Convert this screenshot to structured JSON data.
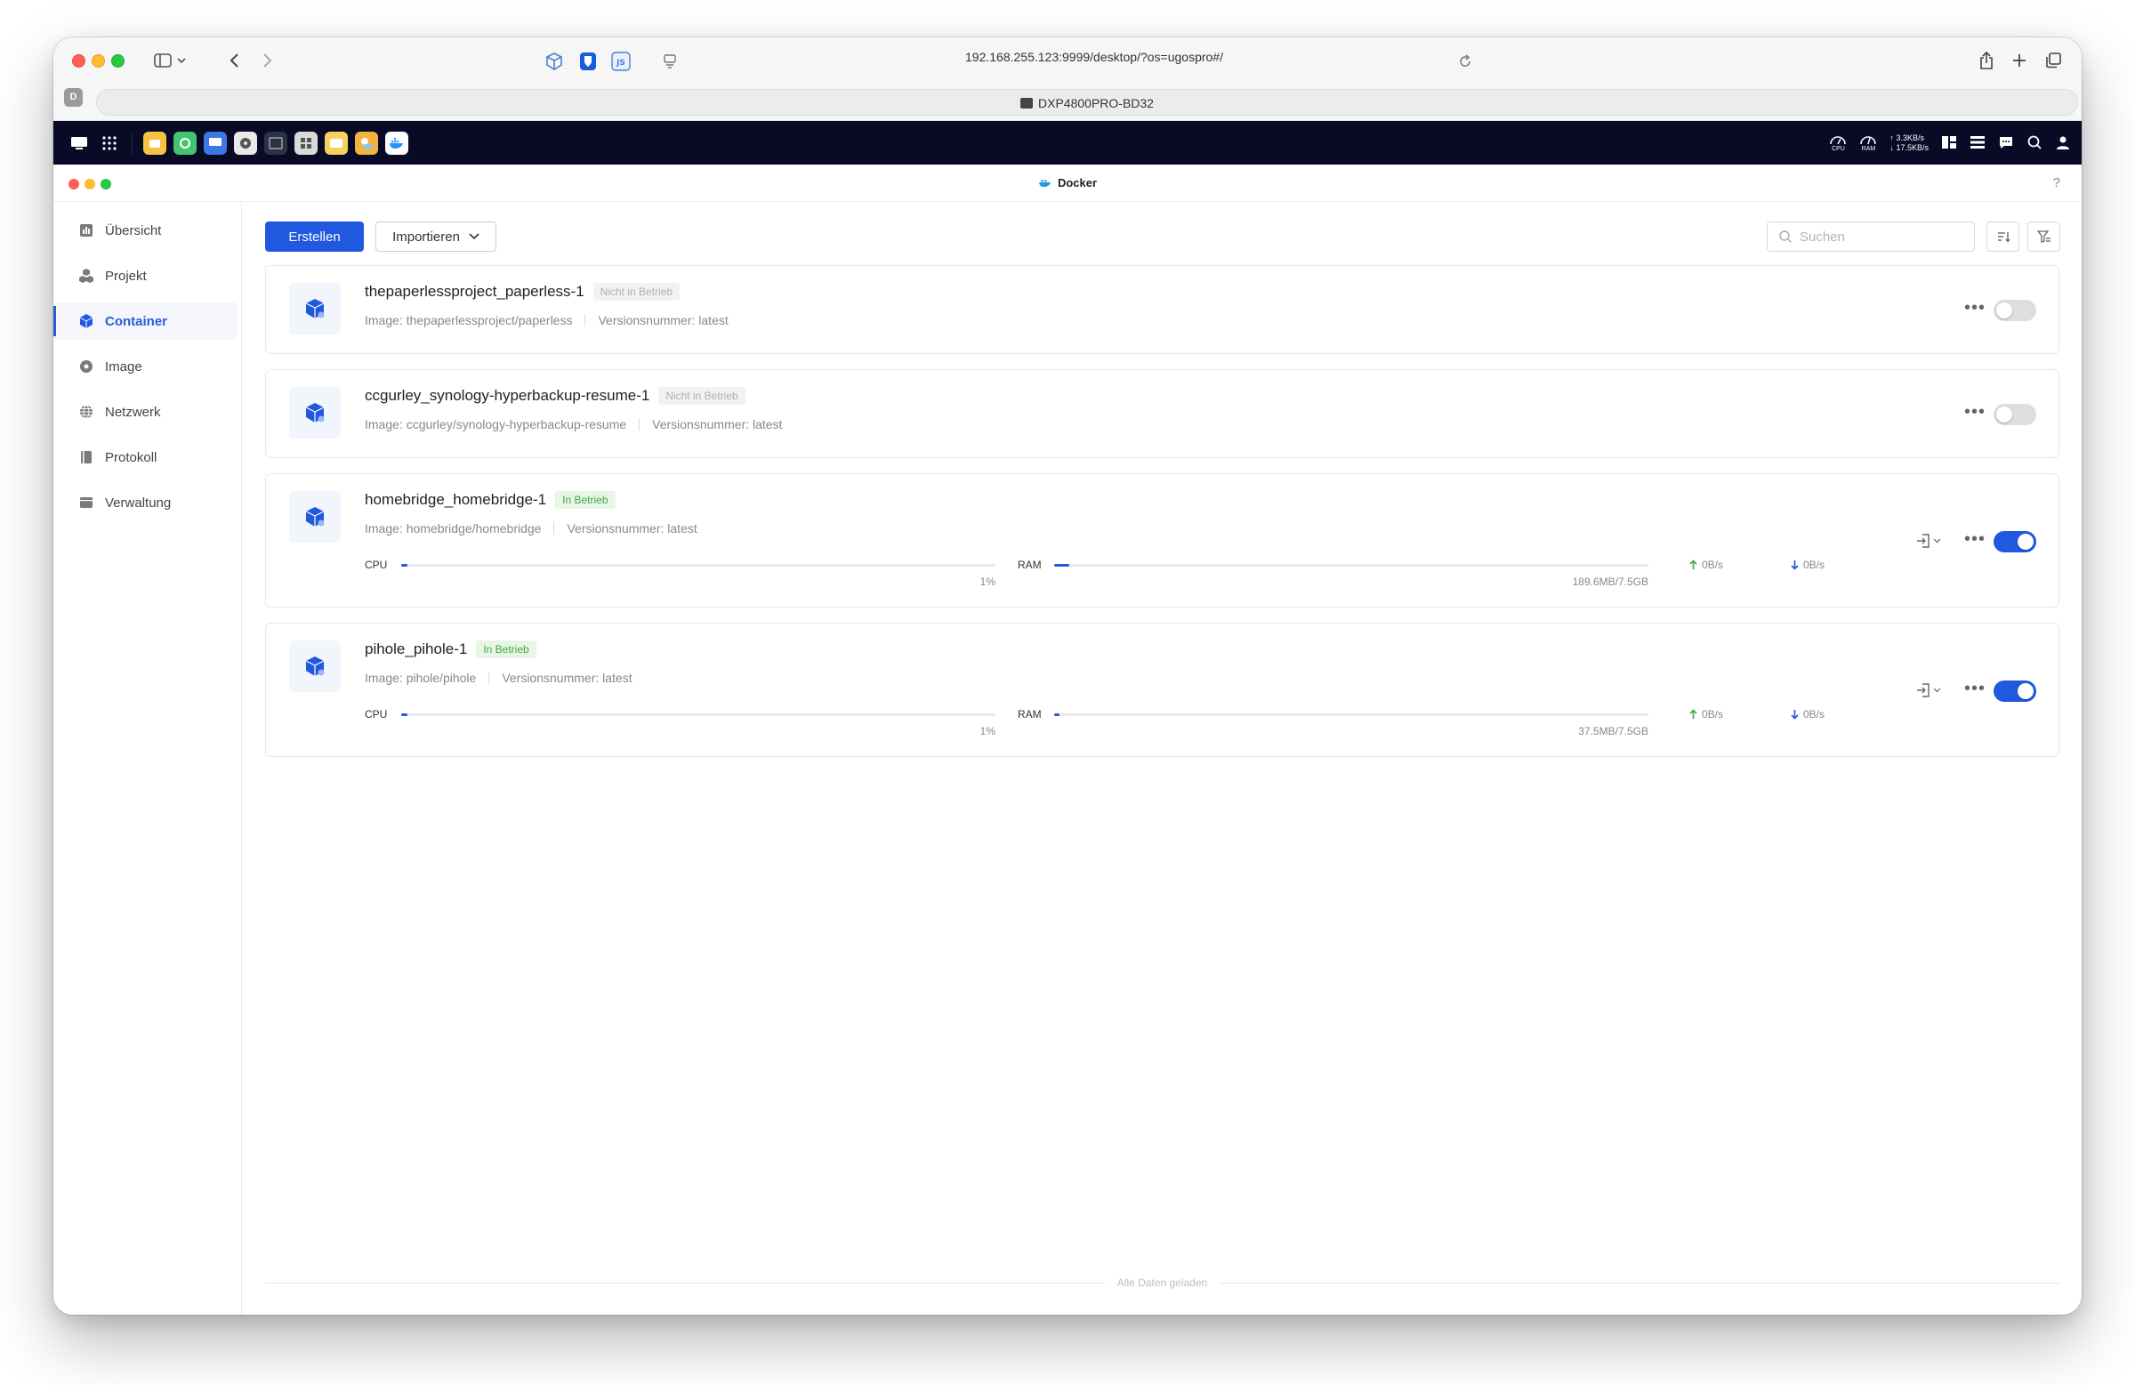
{
  "browser": {
    "url": "192.168.255.123:9999/desktop/?os=ugospro#/",
    "tab_title": "DXP4800PRO-BD32",
    "profile_initial": "D"
  },
  "nas": {
    "upload_speed": "↑ 3.3KB/s",
    "download_speed": "↓ 17.5KB/s",
    "cpu_label": "CPU",
    "ram_label": "RAM"
  },
  "app": {
    "title": "Docker",
    "help": "?"
  },
  "sidebar": {
    "items": [
      {
        "label": "Übersicht"
      },
      {
        "label": "Projekt"
      },
      {
        "label": "Container"
      },
      {
        "label": "Image"
      },
      {
        "label": "Netzwerk"
      },
      {
        "label": "Protokoll"
      },
      {
        "label": "Verwaltung"
      }
    ],
    "active_index": 2
  },
  "toolbar": {
    "create_label": "Erstellen",
    "import_label": "Importieren",
    "search_placeholder": "Suchen"
  },
  "containers": [
    {
      "name": "thepaperlessproject_paperless-1",
      "status": "Nicht in Betrieb",
      "image": "Image: thepaperlessproject/paperless",
      "version": "Versionsnummer: latest",
      "running": false
    },
    {
      "name": "ccgurley_synology-hyperbackup-resume-1",
      "status": "Nicht in Betrieb",
      "image": "Image: ccgurley/synology-hyperbackup-resume",
      "version": "Versionsnummer: latest",
      "running": false
    },
    {
      "name": "homebridge_homebridge-1",
      "status": "In Betrieb",
      "image": "Image: homebridge/homebridge",
      "version": "Versionsnummer: latest",
      "running": true,
      "cpu_label": "CPU",
      "cpu_value": "1%",
      "cpu_fraction": 0.01,
      "ram_label": "RAM",
      "ram_value": "189.6MB/7.5GB",
      "ram_fraction": 0.025,
      "net_up": "0B/s",
      "net_down": "0B/s"
    },
    {
      "name": "pihole_pihole-1",
      "status": "In Betrieb",
      "image": "Image: pihole/pihole",
      "version": "Versionsnummer: latest",
      "running": true,
      "cpu_label": "CPU",
      "cpu_value": "1%",
      "cpu_fraction": 0.01,
      "ram_label": "RAM",
      "ram_value": "37.5MB/7.5GB",
      "ram_fraction": 0.005,
      "net_up": "0B/s",
      "net_down": "0B/s"
    }
  ],
  "footer": {
    "text": "Alle Daten geladen"
  },
  "colors": {
    "accent": "#2158e0",
    "running_badge_bg": "#e8f6e6",
    "running_badge_text": "#3fa843",
    "nas_bar": "#080a26"
  }
}
